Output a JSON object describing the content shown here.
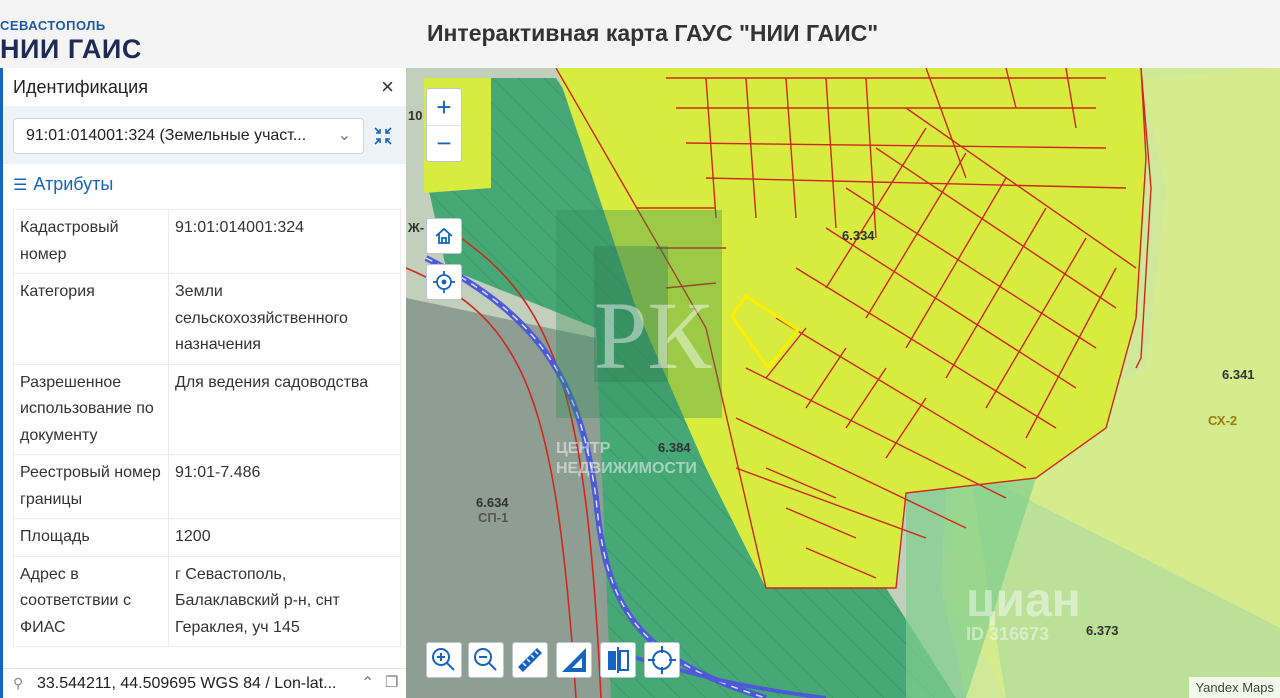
{
  "header": {
    "logo_top": "СЕВАСТОПОЛЬ",
    "logo_main": "НИИ ГАИС",
    "title": "Интерактивная карта ГАУС \"НИИ ГАИС\""
  },
  "panel": {
    "title": "Идентификация",
    "close_label": "×",
    "selected_feature": "91:01:014001:324 (Земельные участ...",
    "attributes_heading": "Атрибуты",
    "attributes": [
      {
        "key": "Кадастровый номер",
        "value": "91:01:014001:324"
      },
      {
        "key": "Категория",
        "value": "Земли сельскохозяйственного назначения"
      },
      {
        "key": "Разрешенное использование по документу",
        "value": "Для ведения садоводства"
      },
      {
        "key": "Реестровый номер границы",
        "value": "91:01-7.486"
      },
      {
        "key": "Площадь",
        "value": "1200"
      },
      {
        "key": "Адрес в соответствии с ФИАС",
        "value": "г Севастополь, Балаклавский р-н, снт Гераклея, уч 145"
      }
    ],
    "coordinates": "33.544211, 44.509695 WGS 84 / Lon-lat..."
  },
  "map": {
    "zoom_in_label": "+",
    "zoom_out_label": "−",
    "zone_labels": {
      "z6334": "6.334",
      "z6384": "6.384",
      "z6634": "6.634",
      "sp1": "СП-1",
      "z6341": "6.341",
      "sx2": "СХ-2",
      "z6373": "6.373",
      "tl_num": "10",
      "tl_code": "Ж-"
    },
    "watermark": {
      "monogram": "РК",
      "line1": "ЦЕНТР",
      "line2": "НЕДВИЖИМОСТИ"
    },
    "cian_watermark": {
      "brand": "циан",
      "id": "ID 316673"
    },
    "attribution": "Yandex Maps",
    "colors": {
      "yellow_zone": "#d7ec3e",
      "green_zone": "#47a877",
      "light_green": "#c8e68c",
      "gray_zone": "#8e9e93",
      "parcel_border": "#d0261e",
      "selected_parcel": "#ffee00",
      "accent": "#1565c0"
    }
  }
}
